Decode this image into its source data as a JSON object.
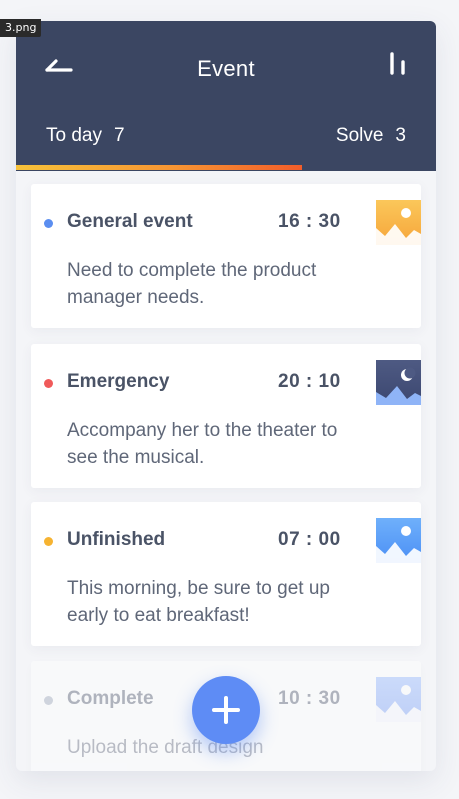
{
  "file_tag": "3.png",
  "header": {
    "title": "Event",
    "today_label": "To day",
    "today_count": "7",
    "solve_label": "Solve",
    "solve_count": "3",
    "progress": 0.68
  },
  "colors": {
    "header_bg": "#3b4662",
    "fab": "#5e8cf5",
    "dot_general": "#5b8ef0",
    "dot_emergency": "#f05a5a",
    "dot_unfinished": "#f6b331",
    "dot_complete": "#9aa3b5"
  },
  "events": [
    {
      "title": "General event",
      "time": "16 : 30",
      "desc": "Need to complete the product manager needs.",
      "dot_color": "#5b8ef0",
      "thumb_icon": "sun-mountain-icon"
    },
    {
      "title": "Emergency",
      "time": "20 : 10",
      "desc": "Accompany her to the theater to see the musical.",
      "dot_color": "#f05a5a",
      "thumb_icon": "moon-mountain-icon"
    },
    {
      "title": "Unfinished",
      "time": "07 : 00",
      "desc": "This morning, be sure to get up early to eat breakfast!",
      "dot_color": "#f6b331",
      "thumb_icon": "sun-mountain-icon"
    },
    {
      "title": "Complete",
      "time": "10 : 30",
      "desc": "Upload the draft design",
      "dot_color": "#9aa3b5",
      "thumb_icon": "sun-mountain-icon"
    }
  ],
  "fab_icon": "plus-icon"
}
